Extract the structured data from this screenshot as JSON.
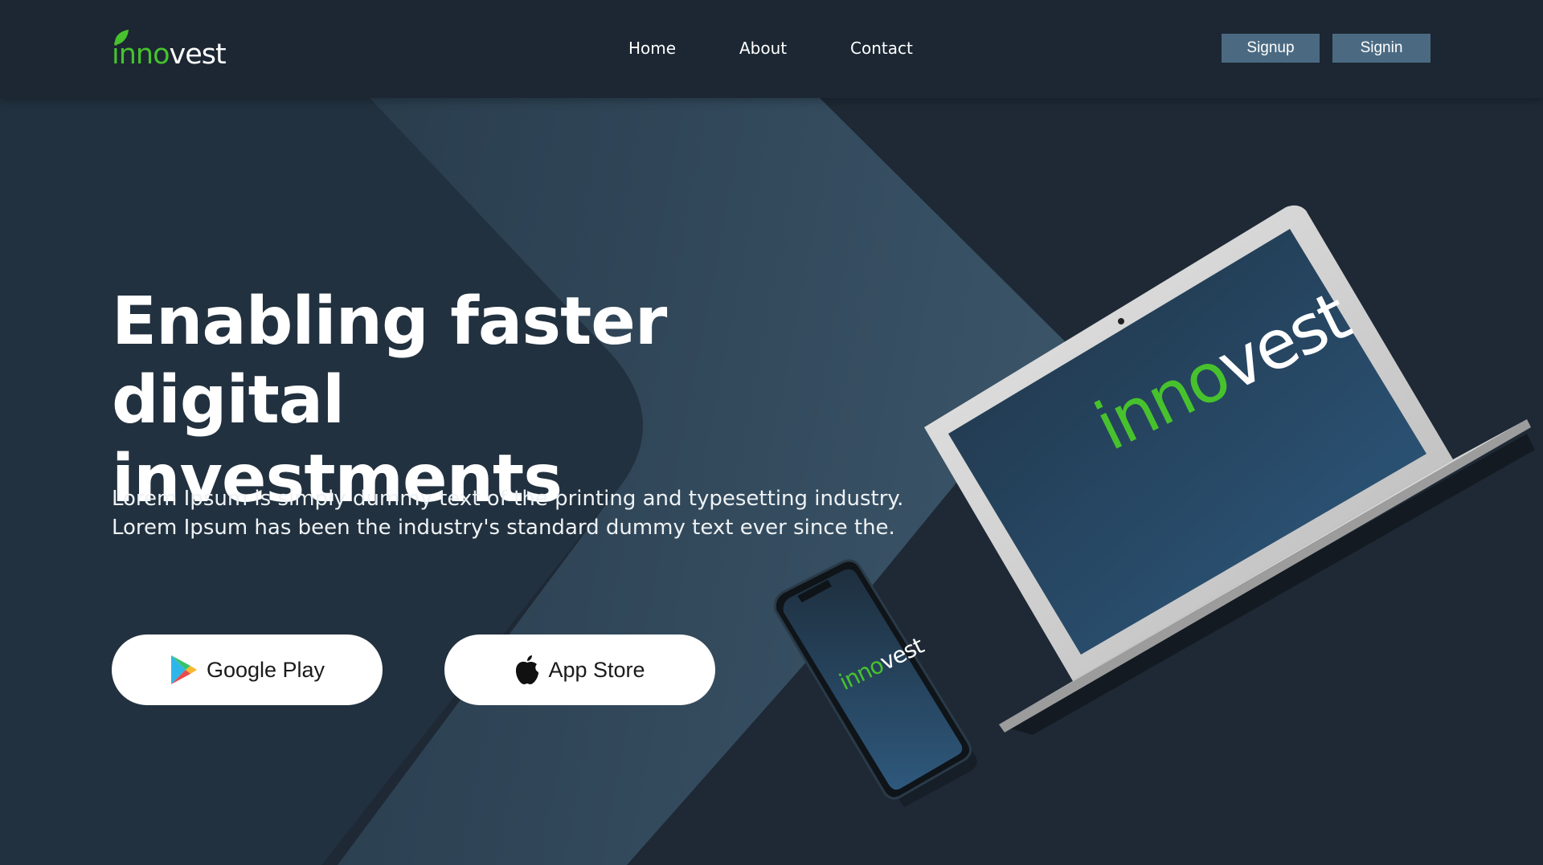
{
  "brand": {
    "name_green": "inno",
    "name_white": "vest",
    "accent_color": "#47c22d"
  },
  "nav": {
    "items": [
      {
        "label": "Home"
      },
      {
        "label": "About"
      },
      {
        "label": "Contact"
      }
    ]
  },
  "auth": {
    "signup_label": "Signup",
    "signin_label": "Signin",
    "button_color": "#4b6a82"
  },
  "hero": {
    "title_line1": "Enabling faster digital",
    "title_line2": "investments",
    "description_line1": "Lorem Ipsum is simply dummy text of the printing and typesetting industry.",
    "description_line2": "Lorem Ipsum has been the industry's standard dummy text ever since the."
  },
  "stores": {
    "google_label": "Google Play",
    "apple_label": "App Store",
    "google_icon": "google-play-icon",
    "apple_icon": "apple-icon"
  },
  "devices": {
    "laptop_logo_green": "inno",
    "laptop_logo_white": "vest",
    "phone_logo_green": "inno",
    "phone_logo_white": "vest"
  }
}
